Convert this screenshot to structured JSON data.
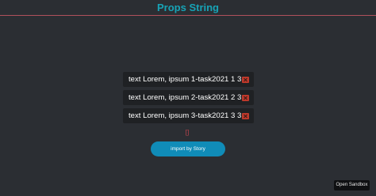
{
  "header": {
    "title": "Props String"
  },
  "items": [
    {
      "text": "text Lorem, ipsum 1-task2021 1 31",
      "delete_icon": "close-icon"
    },
    {
      "text": "text Lorem, ipsum 2-task2021 2 31",
      "delete_icon": "close-icon"
    },
    {
      "text": "text Lorem, ipsum 3-task2021 3 31",
      "delete_icon": "close-icon"
    }
  ],
  "marker": "[]",
  "import_button": {
    "label": "import by Story"
  },
  "sandbox_button": {
    "label": "Open Sandbox"
  },
  "colors": {
    "background": "#2b2e33",
    "title": "#17a3b6",
    "header_border": "#b0505c",
    "item_bg": "#1f2124",
    "delete": "#c0392b",
    "accent_button": "#108cb8"
  }
}
